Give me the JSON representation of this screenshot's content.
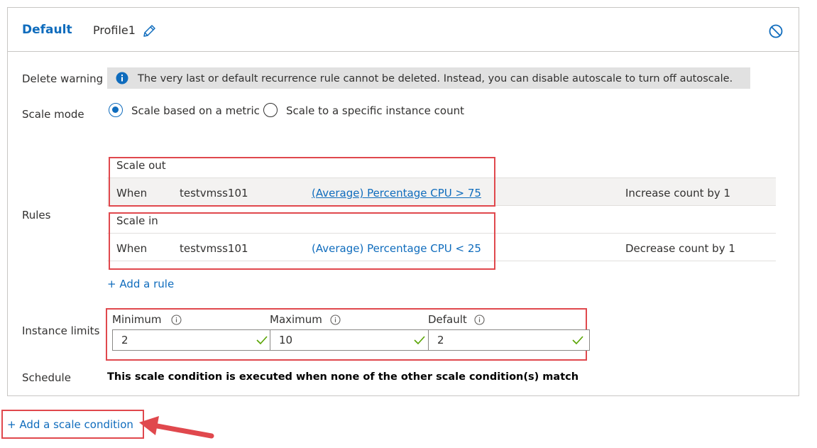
{
  "header": {
    "tab_default": "Default",
    "profile_name": "Profile1",
    "edit_icon": "pencil-icon",
    "disable_icon": "disable-icon"
  },
  "labels": {
    "delete_warning": "Delete warning",
    "scale_mode": "Scale mode",
    "rules": "Rules",
    "instance_limits": "Instance limits",
    "schedule": "Schedule"
  },
  "warning": {
    "icon": "info-icon",
    "text": "The very last or default recurrence rule cannot be deleted. Instead, you can disable autoscale to turn off autoscale."
  },
  "scale_mode": {
    "options": [
      {
        "label": "Scale based on a metric",
        "selected": true
      },
      {
        "label": "Scale to a specific instance count",
        "selected": false
      }
    ]
  },
  "rules": {
    "scale_out": {
      "title": "Scale out",
      "when": "When",
      "resource": "testvmss101",
      "metric": "(Average) Percentage CPU > 75",
      "action": "Increase count by 1"
    },
    "scale_in": {
      "title": "Scale in",
      "when": "When",
      "resource": "testvmss101",
      "metric": "(Average) Percentage CPU < 25",
      "action": "Decrease count by 1"
    },
    "add_rule": "+ Add a rule"
  },
  "instance_limits": {
    "minimum": {
      "label": "Minimum",
      "value": "2"
    },
    "maximum": {
      "label": "Maximum",
      "value": "10"
    },
    "default": {
      "label": "Default",
      "value": "2"
    }
  },
  "schedule": {
    "text": "This scale condition is executed when none of the other scale condition(s) match"
  },
  "add_condition": "+ Add a scale condition",
  "colors": {
    "accent": "#0f6cbd",
    "highlight_red": "#e0484d",
    "valid_green": "#57a300"
  }
}
